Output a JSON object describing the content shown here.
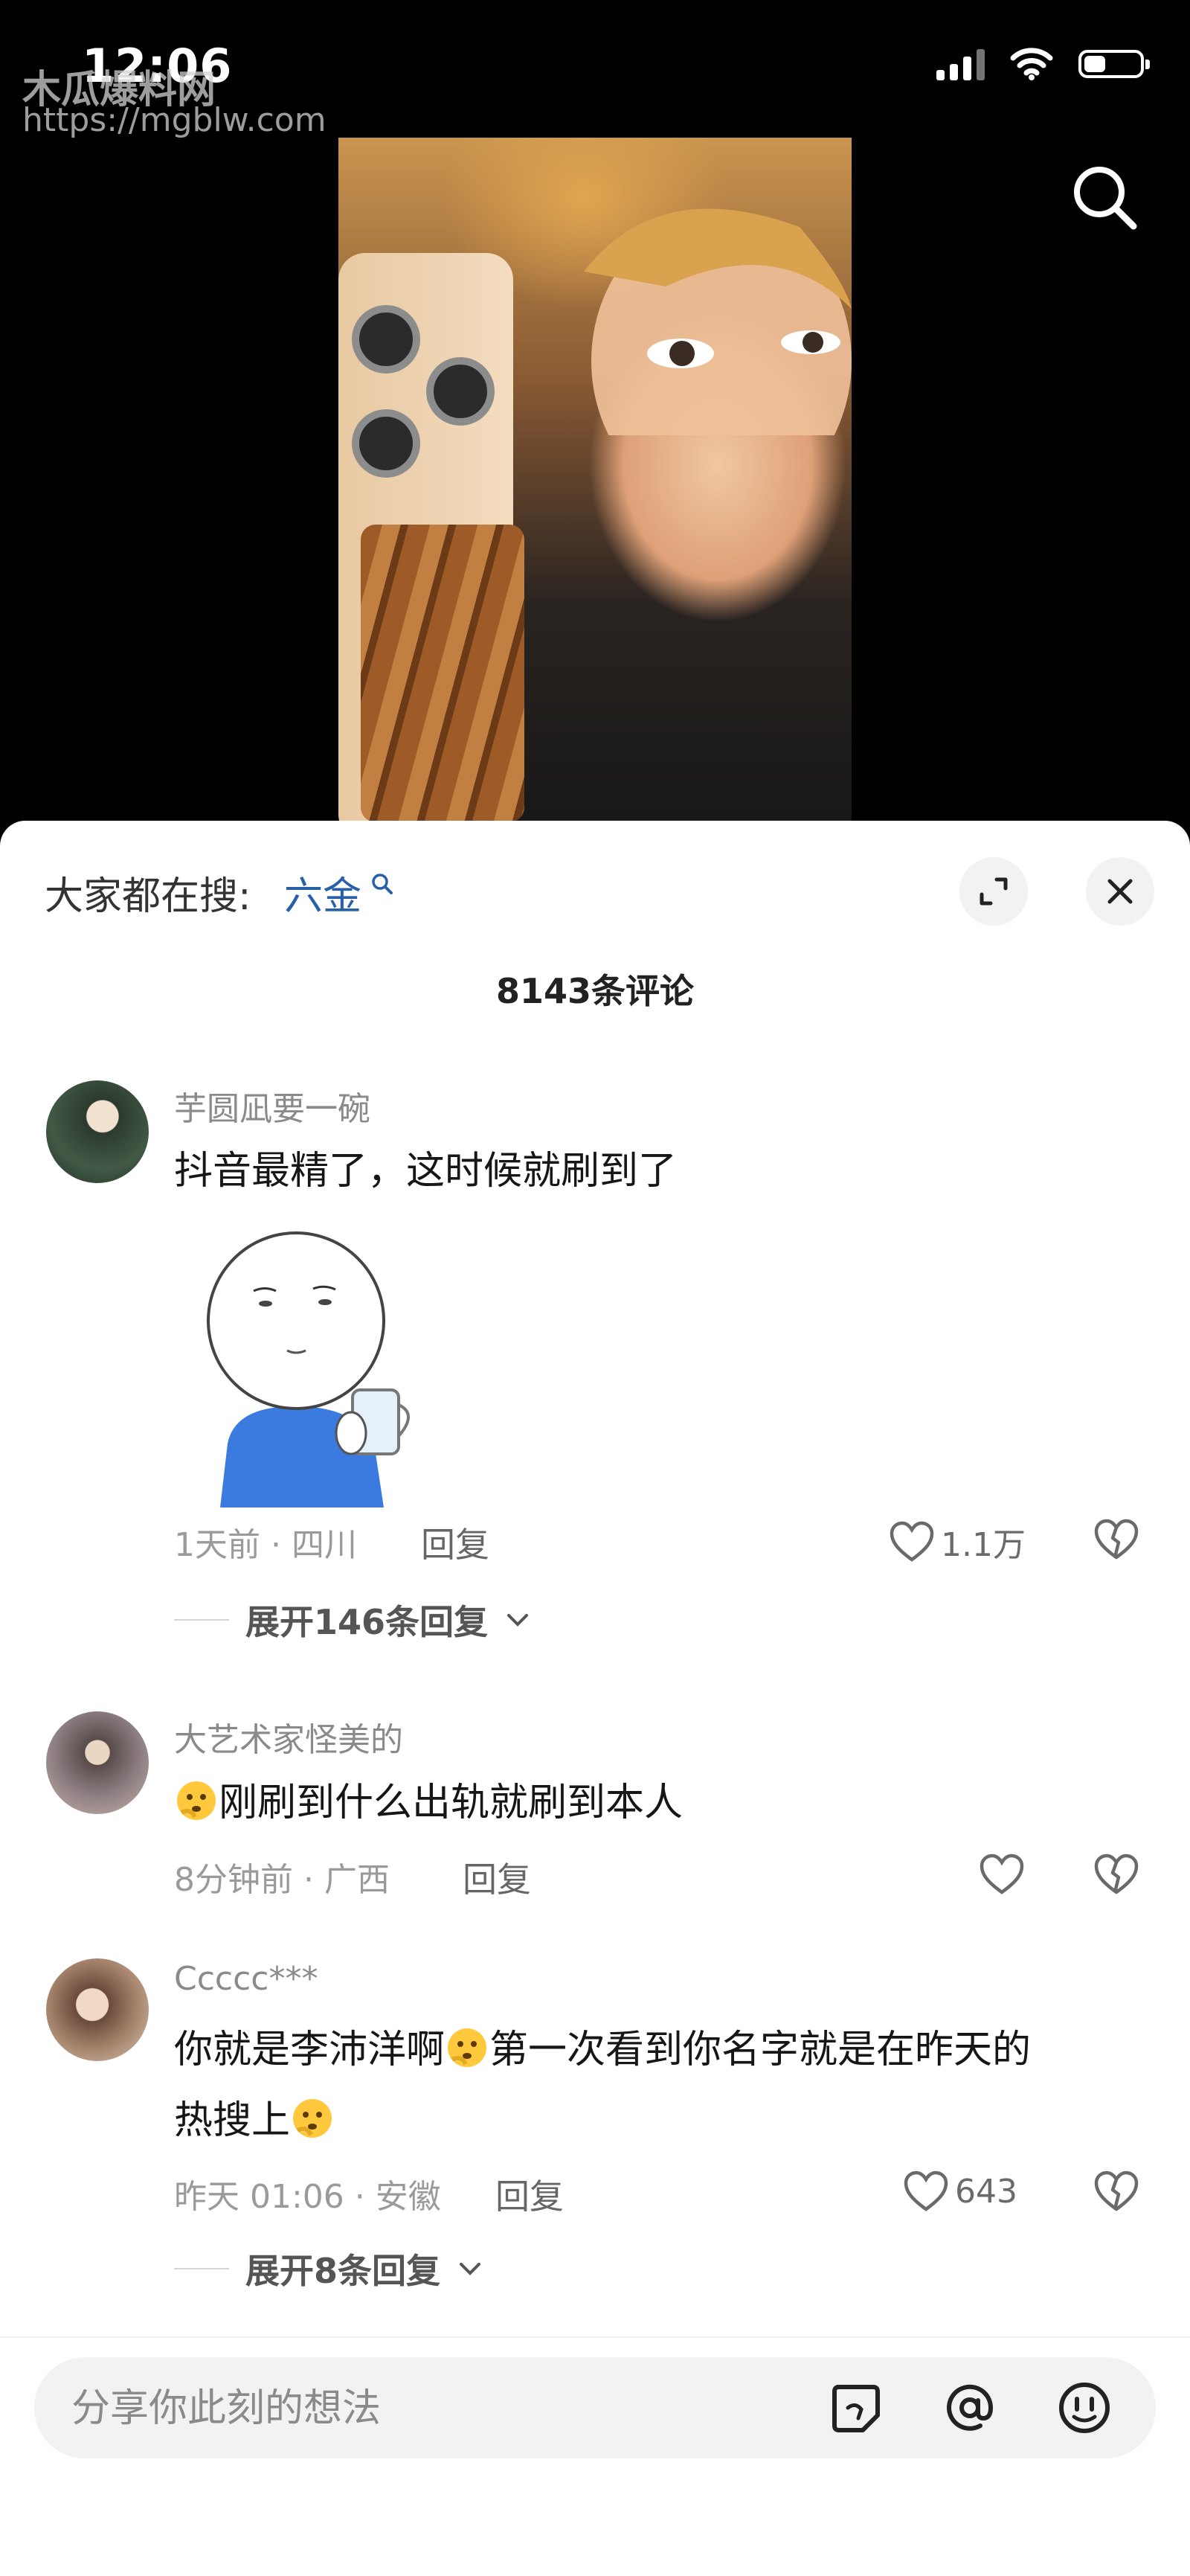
{
  "status": {
    "time": "12:06"
  },
  "watermark": {
    "name": "木瓜爆料网",
    "url": "https://mgblw.com"
  },
  "header": {
    "trending_label": "大家都在搜:",
    "trending_term": "六金"
  },
  "comments_header": {
    "count_label": "8143条评论"
  },
  "comments": [
    {
      "username": "芋圆凪要一碗",
      "text": "抖音最精了，这时候就刷到了",
      "time_location": "1天前 · 四川",
      "reply_label": "回复",
      "likes": "1.1万",
      "expand_replies": "展开146条回复"
    },
    {
      "username": "大艺术家怪美的",
      "text": "刚刷到什么出轨就刷到本人",
      "time_location": "8分钟前 · 广西",
      "reply_label": "回复",
      "likes": ""
    },
    {
      "username": "Ccccc***",
      "text_part1": "你就是李沛洋啊",
      "text_part2": "第一次看到你名字就是在昨天的",
      "text_part3": "热搜上",
      "time_location": "昨天 01:06 · 安徽",
      "reply_label": "回复",
      "likes": "643",
      "expand_replies": "展开8条回复"
    }
  ],
  "input": {
    "placeholder": "分享你此刻的想法"
  },
  "icons": {
    "search": "search-icon",
    "expand": "expand-icon",
    "close": "close-icon",
    "heart": "heart-icon",
    "broken-heart": "broken-heart-icon",
    "sticker": "sticker-icon",
    "mention": "at-icon",
    "emoji": "emoji-icon",
    "thinking-emoji": "thinking-emoji-icon",
    "chevron": "chevron-down-icon"
  }
}
